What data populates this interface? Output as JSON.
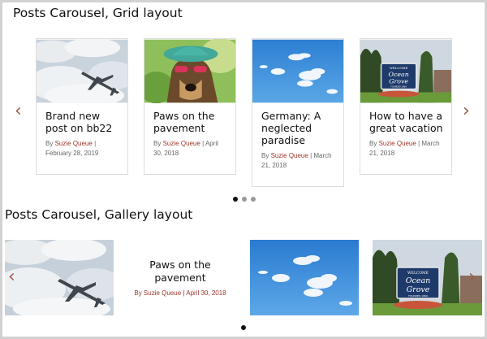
{
  "grid": {
    "title": "Posts Carousel, Grid layout",
    "prev_arrow": "‹",
    "next_arrow": "›",
    "by_label": "By",
    "posts": [
      {
        "title": "Brand new post on bb22",
        "author": "Suzie Queue",
        "date": "February 28, 2019",
        "image": "airplane-photo"
      },
      {
        "title": "Paws on the pavement",
        "author": "Suzie Queue",
        "date": "April 30, 2018",
        "image": "dog-with-sunglasses-photo"
      },
      {
        "title": "Germany: A neglected paradise",
        "author": "Suzie Queue",
        "date": "March 21, 2018",
        "image": "blue-sky-clouds-photo"
      },
      {
        "title": "How to have a great vacation",
        "author": "Suzie Queue",
        "date": "March 21, 2018",
        "image": "ocean-grove-sign-photo"
      }
    ],
    "pagination": {
      "count": 3,
      "active": 0
    }
  },
  "gallery": {
    "title": "Posts Carousel, Gallery layout",
    "prev_arrow": "‹",
    "next_arrow": "›",
    "featured": {
      "title": "Paws on the pavement",
      "meta": "By Suzie Queue | April 30, 2018"
    },
    "sign_lines": [
      "WELCOME",
      "Ocean",
      "Grove",
      "FOUNDED 1869"
    ],
    "pagination": {
      "count": 1,
      "active": 0
    }
  },
  "colors": {
    "accent": "#a0352a",
    "arrow": "#9c5c4e",
    "dot_active": "#111111",
    "dot_inactive": "#999999"
  }
}
